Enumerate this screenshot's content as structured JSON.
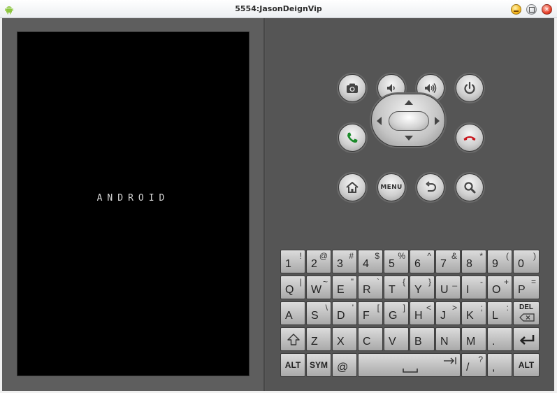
{
  "window": {
    "title": "5554:JasonDeignVip",
    "icons": {
      "app": "android-robot-icon",
      "minimize": "minimize-icon",
      "maximize": "maximize-icon",
      "close": "close-icon"
    }
  },
  "screen": {
    "boot_text": "ANDROID"
  },
  "hardware_buttons": {
    "camera": "camera-icon",
    "volume_down": "volume-down-icon",
    "volume_up": "volume-up-icon",
    "power": "power-icon",
    "call": "call-icon",
    "end_call": "end-call-icon",
    "home": "home-icon",
    "menu_label": "MENU",
    "back": "back-icon",
    "search": "search-icon"
  },
  "keyboard": {
    "row1": [
      {
        "main": "1",
        "alt": "!"
      },
      {
        "main": "2",
        "alt": "@"
      },
      {
        "main": "3",
        "alt": "#"
      },
      {
        "main": "4",
        "alt": "$"
      },
      {
        "main": "5",
        "alt": "%"
      },
      {
        "main": "6",
        "alt": "^"
      },
      {
        "main": "7",
        "alt": "&"
      },
      {
        "main": "8",
        "alt": "*"
      },
      {
        "main": "9",
        "alt": "("
      },
      {
        "main": "0",
        "alt": ")"
      }
    ],
    "row2": [
      {
        "main": "Q",
        "alt": "|"
      },
      {
        "main": "W",
        "alt": "~"
      },
      {
        "main": "E",
        "alt": "\""
      },
      {
        "main": "R",
        "alt": "`"
      },
      {
        "main": "T",
        "alt": "{"
      },
      {
        "main": "Y",
        "alt": "}"
      },
      {
        "main": "U",
        "alt": "_"
      },
      {
        "main": "I",
        "alt": "-"
      },
      {
        "main": "O",
        "alt": "+"
      },
      {
        "main": "P",
        "alt": "="
      }
    ],
    "row3": [
      {
        "main": "A",
        "alt": ""
      },
      {
        "main": "S",
        "alt": "\\"
      },
      {
        "main": "D",
        "alt": "'"
      },
      {
        "main": "F",
        "alt": "["
      },
      {
        "main": "G",
        "alt": "]"
      },
      {
        "main": "H",
        "alt": "<"
      },
      {
        "main": "J",
        "alt": ">"
      },
      {
        "main": "K",
        "alt": ";"
      },
      {
        "main": "L",
        "alt": ":"
      }
    ],
    "del_label": "DEL",
    "row4": [
      {
        "main": "Z",
        "alt": ""
      },
      {
        "main": "X",
        "alt": ""
      },
      {
        "main": "C",
        "alt": ""
      },
      {
        "main": "V",
        "alt": ""
      },
      {
        "main": "B",
        "alt": ""
      },
      {
        "main": "N",
        "alt": ""
      },
      {
        "main": "M",
        "alt": ""
      },
      {
        "main": ".",
        "alt": ""
      }
    ],
    "shift_icon": "shift-icon",
    "enter_icon": "enter-icon",
    "row5": {
      "alt_left": "ALT",
      "sym": "SYM",
      "at": "@",
      "space_icon": "space-icon",
      "tab_icon": "tab-icon",
      "slash": {
        "main": "/",
        "alt": "?"
      },
      "comma": ",",
      "alt_right": "ALT"
    }
  },
  "colors": {
    "call_green": "#1b8a2a",
    "end_call_red": "#c8161d",
    "body_gray": "#575757"
  }
}
